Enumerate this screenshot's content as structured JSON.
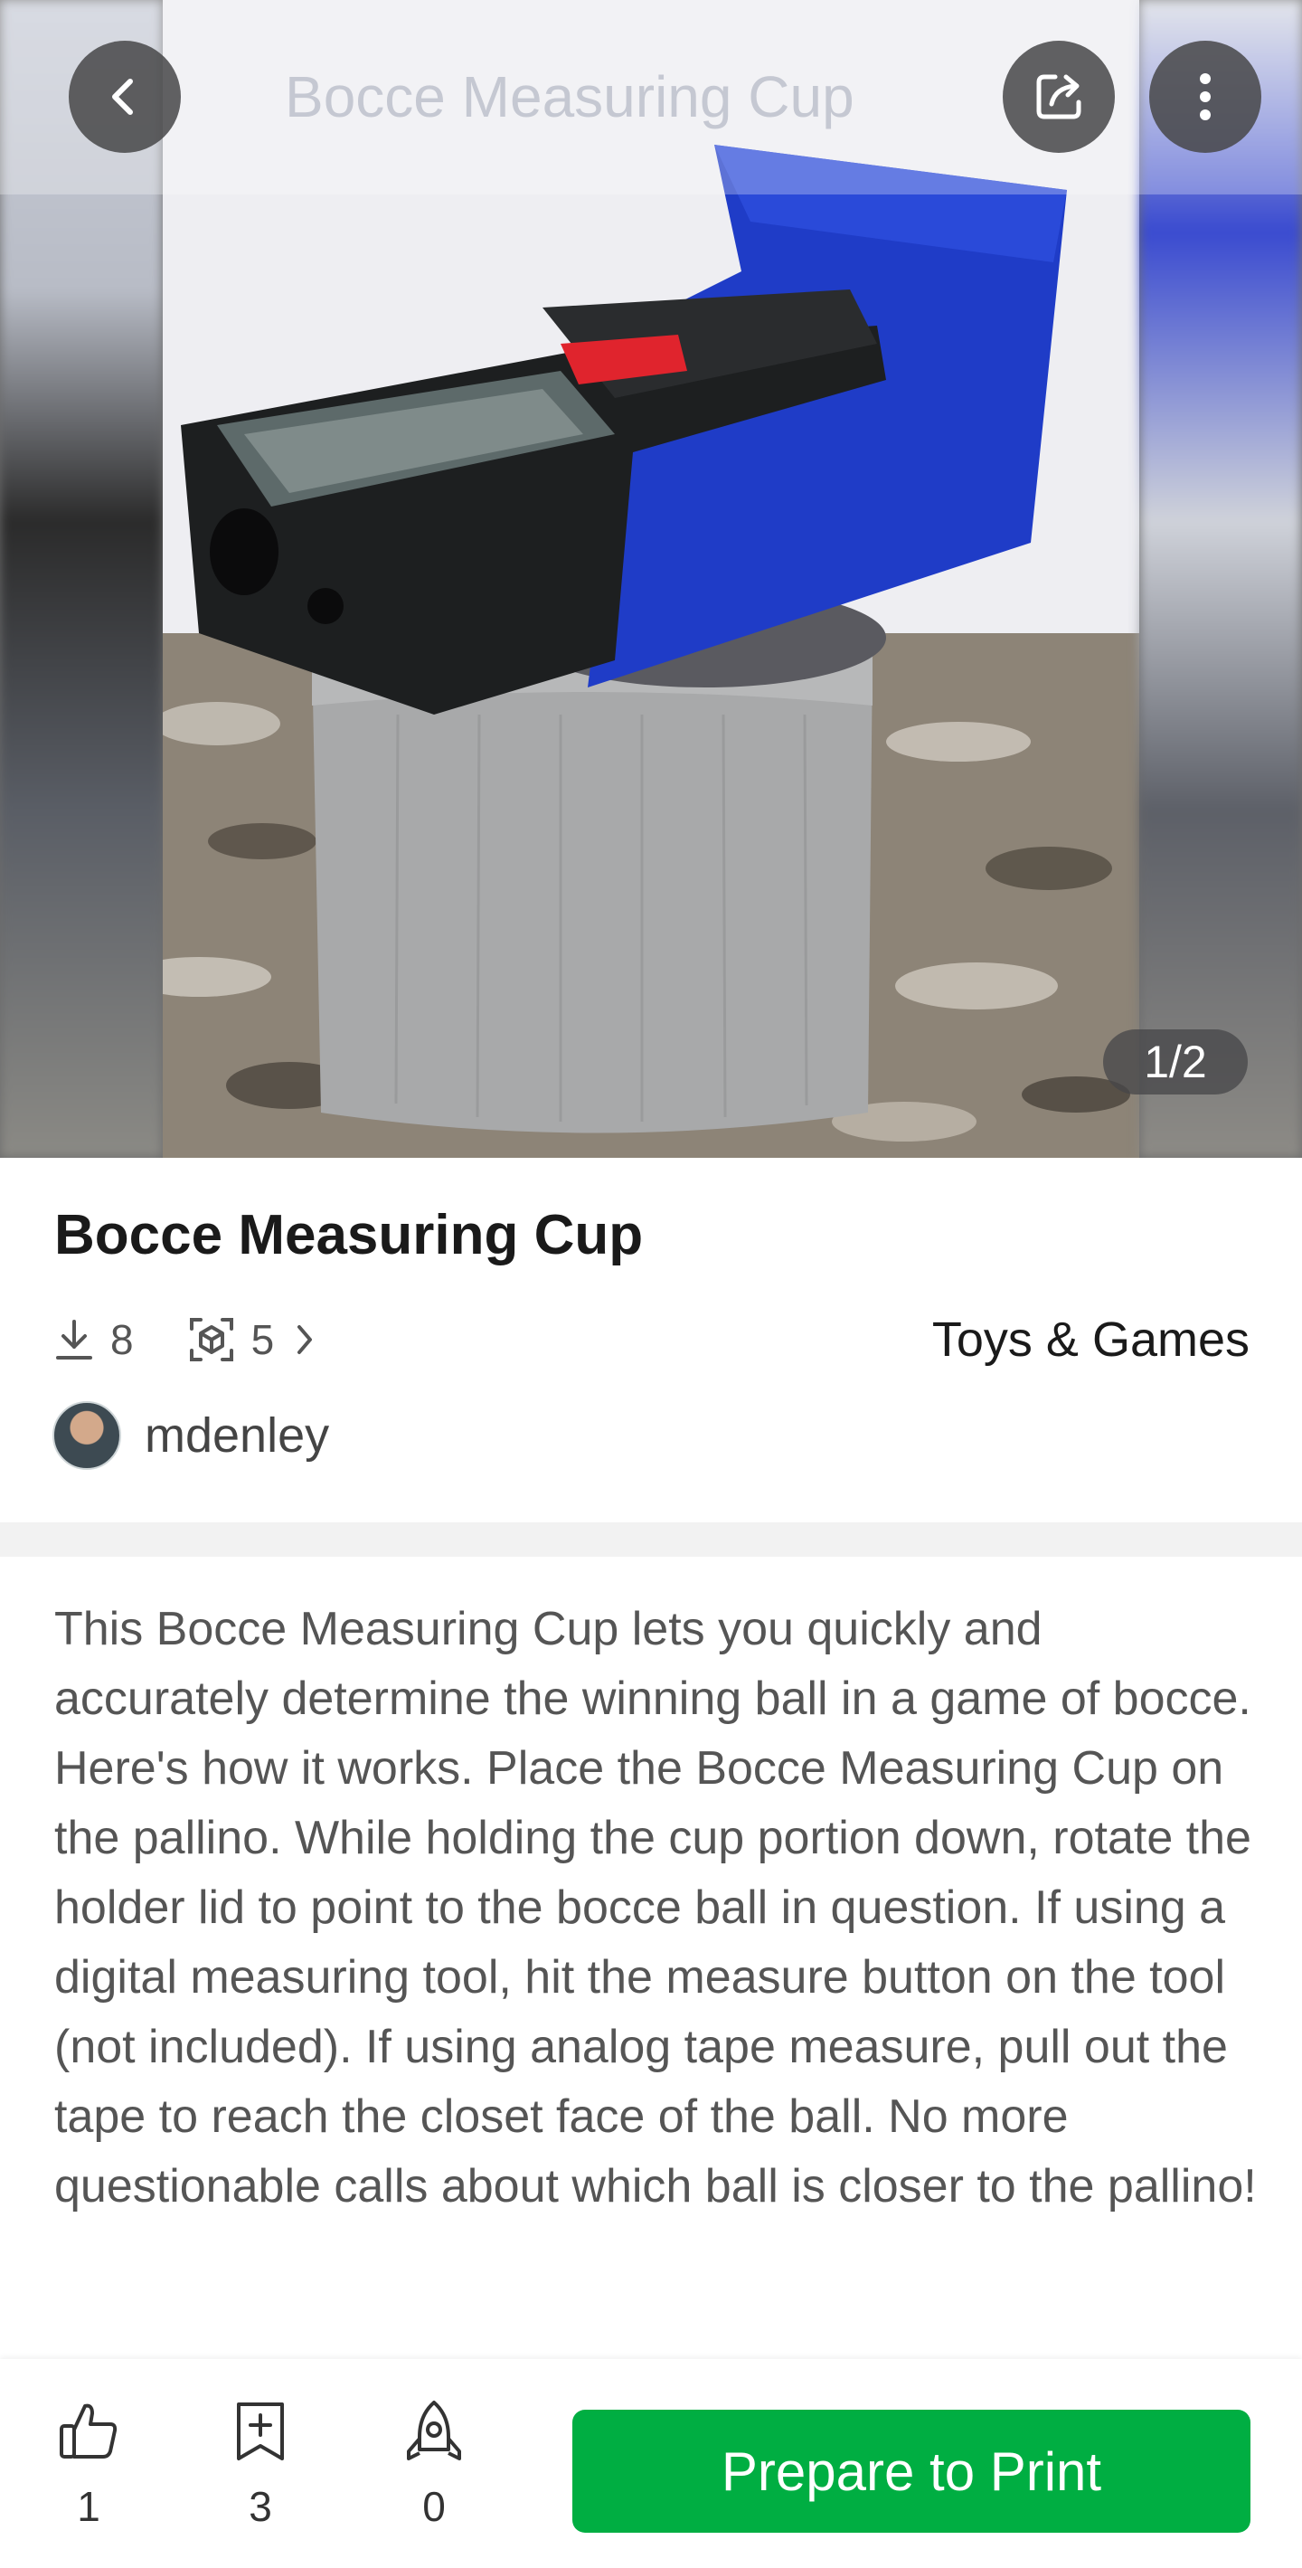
{
  "header": {
    "title": "Bocce Measuring Cup",
    "image_counter": "1/2"
  },
  "model": {
    "title": "Bocce Measuring Cup",
    "downloads": "8",
    "prints": "5",
    "category": "Toys & Games",
    "author": "mdenley",
    "description": "This Bocce Measuring Cup lets you quickly and accurately determine the winning ball in a game of bocce. Here's how it works. Place the Bocce Measuring Cup on the pallino. While holding the cup portion down, rotate the holder lid to point to the bocce ball in question. If using a digital measuring tool, hit the measure button on the tool (not included). If using analog tape measure, pull out the tape to reach the closet face of the ball. No more questionable calls about which ball is closer to the pallino!"
  },
  "actions": {
    "likes": "1",
    "collects": "3",
    "boosts": "0",
    "print_label": "Prepare to Print"
  },
  "icons": {
    "back": "chevron-left-icon",
    "share": "share-icon",
    "more": "more-vertical-icon",
    "download": "download-icon",
    "print": "cube-print-icon",
    "like": "thumbs-up-icon",
    "collect": "bookmark-plus-icon",
    "boost": "rocket-icon"
  },
  "colors": {
    "primary_button": "#00ae42",
    "nav_button_bg": "#464648"
  }
}
